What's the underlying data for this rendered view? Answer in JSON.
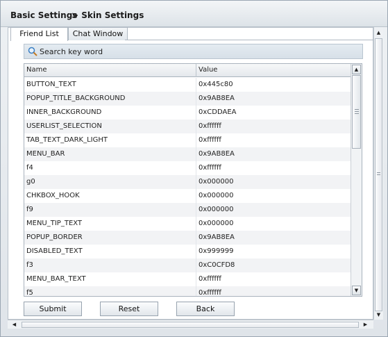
{
  "header": {
    "crumb_basic": "Basic Settings",
    "crumb_skin": "> Skin Settings"
  },
  "tabs": [
    {
      "label": "Friend List",
      "active": true
    },
    {
      "label": "Chat Window",
      "active": false
    }
  ],
  "search": {
    "placeholder": "Search key word",
    "icon": "search-icon"
  },
  "table": {
    "columns": [
      "Name",
      "Value"
    ],
    "rows": [
      [
        "BUTTON_TEXT",
        "0x445c80"
      ],
      [
        "POPUP_TITLE_BACKGROUND",
        "0x9AB8EA"
      ],
      [
        "INNER_BACKGROUND",
        "0xCDDAEA"
      ],
      [
        "USERLIST_SELECTION",
        "0xffffff"
      ],
      [
        "TAB_TEXT_DARK_LIGHT",
        "0xffffff"
      ],
      [
        "MENU_BAR",
        "0x9AB8EA"
      ],
      [
        "f4",
        "0xffffff"
      ],
      [
        "g0",
        "0x000000"
      ],
      [
        "CHKBOX_HOOK",
        "0x000000"
      ],
      [
        "f9",
        "0x000000"
      ],
      [
        "MENU_TIP_TEXT",
        "0x000000"
      ],
      [
        "POPUP_BORDER",
        "0x9AB8EA"
      ],
      [
        "DISABLED_TEXT",
        "0x999999"
      ],
      [
        "f3",
        "0xC0CFD8"
      ],
      [
        "MENU_BAR_TEXT",
        "0xffffff"
      ],
      [
        "f5",
        "0xffffff"
      ]
    ]
  },
  "buttons": {
    "submit": "Submit",
    "reset": "Reset",
    "back": "Back"
  },
  "scroll_icons": {
    "up": "▲",
    "down": "▼",
    "left": "◀",
    "right": "▶"
  }
}
